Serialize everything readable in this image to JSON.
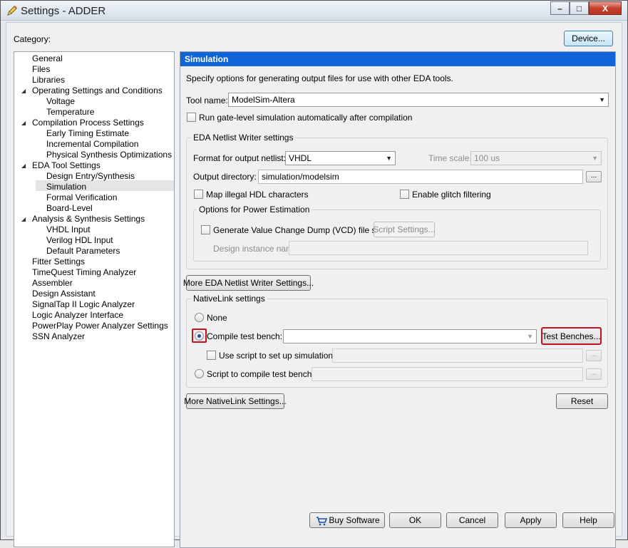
{
  "window": {
    "title": "Settings - ADDER",
    "min": "–",
    "max": "□",
    "close": "X"
  },
  "category_label": "Category:",
  "device_button": "Device...",
  "tree": {
    "items": [
      {
        "label": "General",
        "level": 0
      },
      {
        "label": "Files",
        "level": 0
      },
      {
        "label": "Libraries",
        "level": 0
      },
      {
        "label": "Operating Settings and Conditions",
        "level": 0,
        "expanded": true
      },
      {
        "label": "Voltage",
        "level": 1
      },
      {
        "label": "Temperature",
        "level": 1
      },
      {
        "label": "Compilation Process Settings",
        "level": 0,
        "expanded": true
      },
      {
        "label": "Early Timing Estimate",
        "level": 1
      },
      {
        "label": "Incremental Compilation",
        "level": 1
      },
      {
        "label": "Physical Synthesis Optimizations",
        "level": 1
      },
      {
        "label": "EDA Tool Settings",
        "level": 0,
        "expanded": true
      },
      {
        "label": "Design Entry/Synthesis",
        "level": 1
      },
      {
        "label": "Simulation",
        "level": 1,
        "selected": true
      },
      {
        "label": "Formal Verification",
        "level": 1
      },
      {
        "label": "Board-Level",
        "level": 1
      },
      {
        "label": "Analysis & Synthesis Settings",
        "level": 0,
        "expanded": true
      },
      {
        "label": "VHDL Input",
        "level": 1
      },
      {
        "label": "Verilog HDL Input",
        "level": 1
      },
      {
        "label": "Default Parameters",
        "level": 1
      },
      {
        "label": "Fitter Settings",
        "level": 0
      },
      {
        "label": "TimeQuest Timing Analyzer",
        "level": 0
      },
      {
        "label": "Assembler",
        "level": 0
      },
      {
        "label": "Design Assistant",
        "level": 0
      },
      {
        "label": "SignalTap II Logic Analyzer",
        "level": 0
      },
      {
        "label": "Logic Analyzer Interface",
        "level": 0
      },
      {
        "label": "PowerPlay Power Analyzer Settings",
        "level": 0
      },
      {
        "label": "SSN Analyzer",
        "level": 0
      }
    ]
  },
  "panel": {
    "title": "Simulation",
    "description": "Specify options for generating output files for use with other EDA tools.",
    "tool_name_label": "Tool name:",
    "tool_name_value": "ModelSim-Altera",
    "run_gate_level_label": "Run gate-level simulation automatically after compilation",
    "eda_group_title": "EDA Netlist Writer settings",
    "format_label": "Format for output netlist:",
    "format_value": "VHDL",
    "time_scale_label": "Time scale:",
    "time_scale_value": "100 us",
    "output_dir_label": "Output directory:",
    "output_dir_value": "simulation/modelsim",
    "browse_label": "...",
    "map_illegal_label": "Map illegal HDL characters",
    "enable_glitch_label": "Enable glitch filtering",
    "power_group_title": "Options for Power Estimation",
    "vcd_label": "Generate Value Change Dump (VCD) file script",
    "script_settings_button": "Script Settings...",
    "design_instance_label": "Design instance name:",
    "more_eda_button": "More EDA Netlist Writer Settings...",
    "nativelink_group_title": "NativeLink settings",
    "none_label": "None",
    "compile_test_bench_label": "Compile test bench:",
    "test_benches_button": "Test Benches...",
    "use_script_label": "Use script to set up simulation:",
    "script_compile_label": "Script to compile test bench:",
    "more_nativelink_button": "More NativeLink Settings...",
    "reset_button": "Reset"
  },
  "footer": {
    "buy_software": "Buy Software",
    "ok": "OK",
    "cancel": "Cancel",
    "apply": "Apply",
    "help": "Help"
  },
  "colors": {
    "panel_header": "#0f64d8",
    "highlight": "#c0121f"
  }
}
